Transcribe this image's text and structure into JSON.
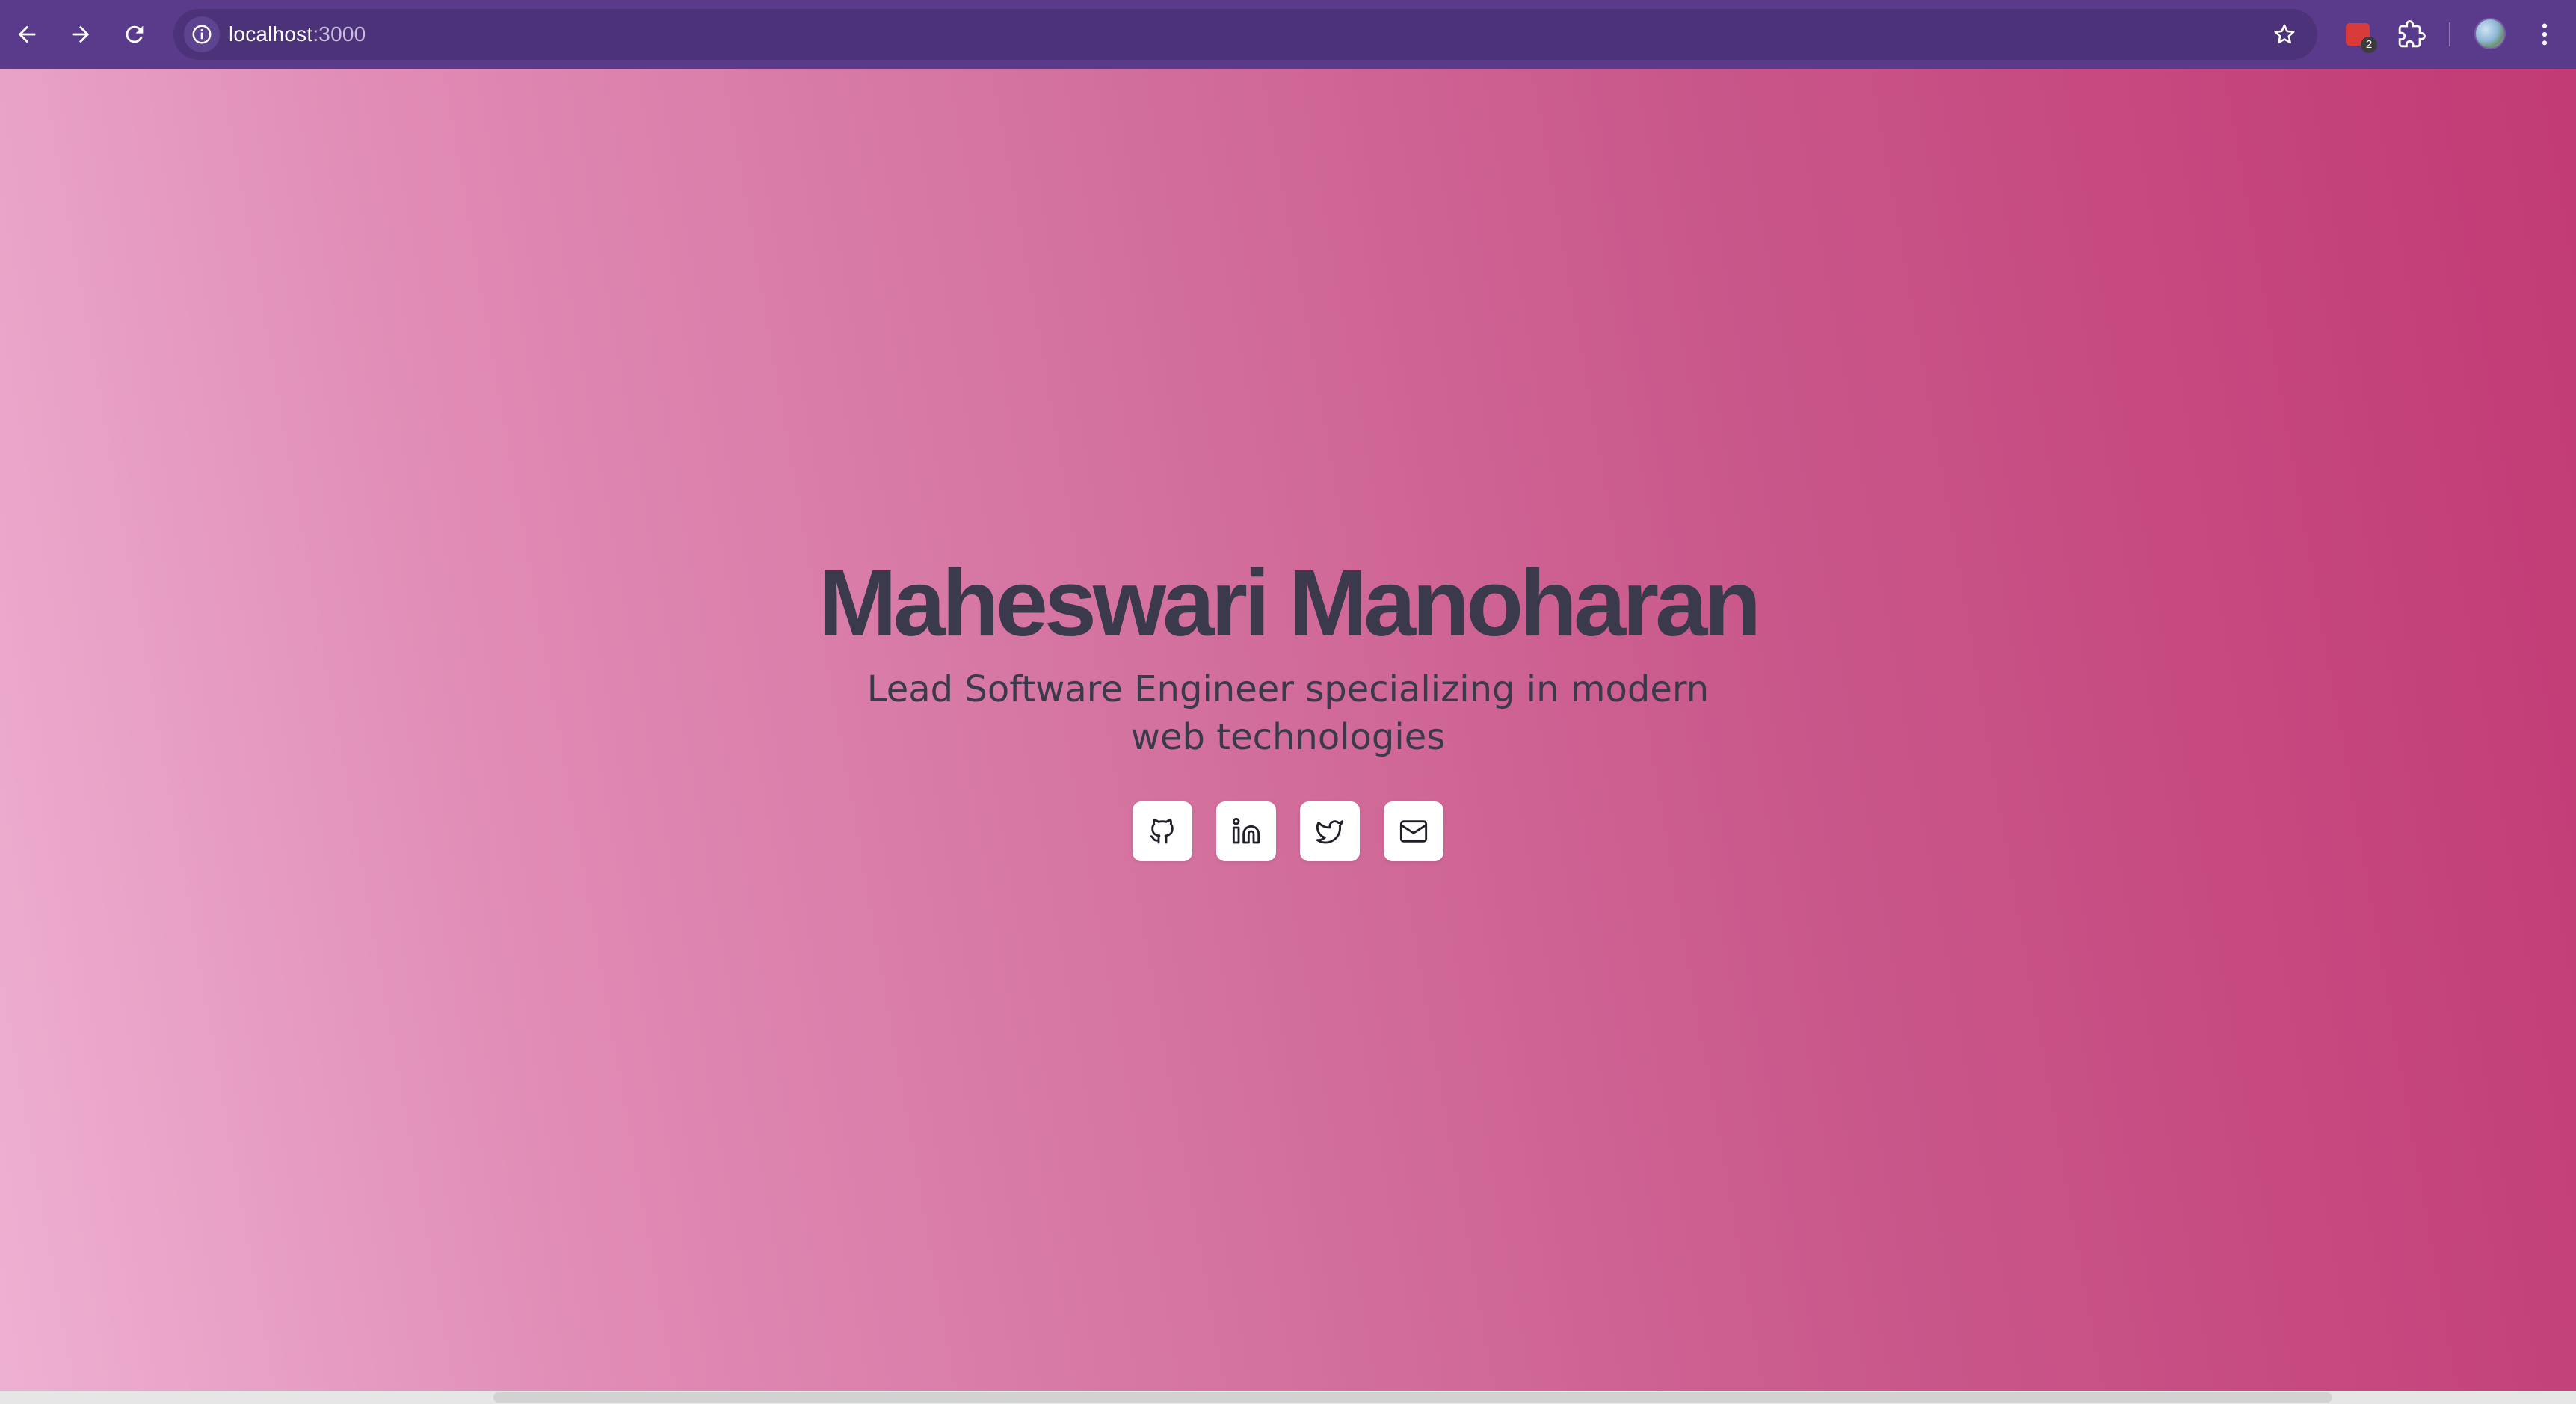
{
  "browser": {
    "url_host": "localhost",
    "url_port": ":3000",
    "extension_badge": "2"
  },
  "hero": {
    "name": "Maheswari Manoharan",
    "tagline": "Lead Software Engineer specializing in modern web technologies"
  },
  "socials": [
    {
      "icon": "github-icon"
    },
    {
      "icon": "linkedin-icon"
    },
    {
      "icon": "twitter-icon"
    },
    {
      "icon": "mail-icon"
    }
  ]
}
